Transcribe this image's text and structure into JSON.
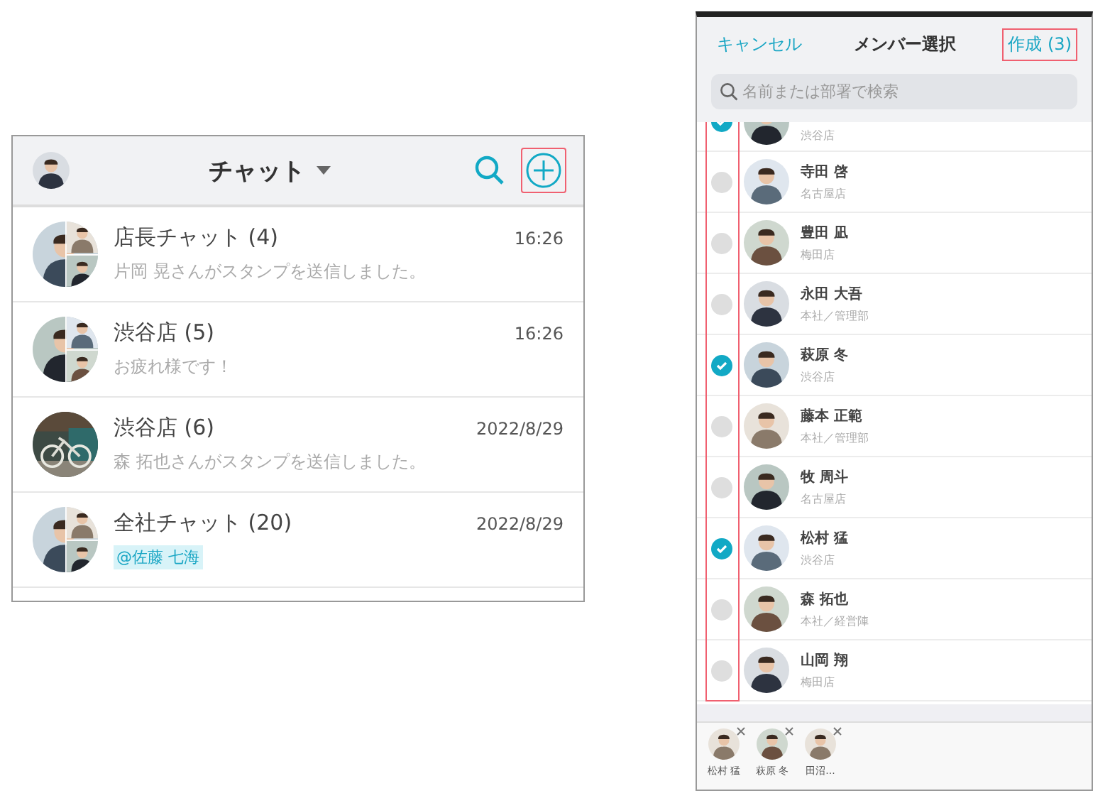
{
  "chat_screen": {
    "header": {
      "title": "チャット",
      "new_chat_highlighted": true
    },
    "chats": [
      {
        "title": "店長チャット (4)",
        "time": "16:26",
        "preview": "片岡 晃さんがスタンプを送信しました。",
        "kind": "text"
      },
      {
        "title": "渋谷店 (5)",
        "time": "16:26",
        "preview": "お疲れ様です！",
        "kind": "text"
      },
      {
        "title": "渋谷店 (6)",
        "time": "2022/8/29",
        "preview": "森 拓也さんがスタンプを送信しました。",
        "kind": "text"
      },
      {
        "title": "全社チャット (20)",
        "time": "2022/8/29",
        "preview": "@佐藤 七海",
        "kind": "mention"
      }
    ]
  },
  "member_select": {
    "cancel": "キャンセル",
    "title": "メンバー選択",
    "create": "作成 (3)",
    "create_highlighted": true,
    "search": {
      "placeholder": "名前または部署で検索"
    },
    "checkboxes_highlighted": true,
    "members": [
      {
        "department": "渋谷店",
        "selected": true
      },
      {
        "name": "寺田 啓",
        "department": "名古屋店",
        "selected": false
      },
      {
        "name": "豊田 凪",
        "department": "梅田店",
        "selected": false
      },
      {
        "name": "永田 大吾",
        "department": "本社／管理部",
        "selected": false
      },
      {
        "name": "萩原 冬",
        "department": "渋谷店",
        "selected": true
      },
      {
        "name": "藤本 正範",
        "department": "本社／管理部",
        "selected": false
      },
      {
        "name": "牧 周斗",
        "department": "名古屋店",
        "selected": false
      },
      {
        "name": "松村 猛",
        "department": "渋谷店",
        "selected": true
      },
      {
        "name": "森 拓也",
        "department": "本社／経営陣",
        "selected": false
      },
      {
        "name": "山岡 翔",
        "department": "梅田店",
        "selected": false
      }
    ],
    "selected_tray": [
      {
        "name": "松村 猛"
      },
      {
        "name": "萩原 冬"
      },
      {
        "name": "田沼..."
      }
    ]
  }
}
